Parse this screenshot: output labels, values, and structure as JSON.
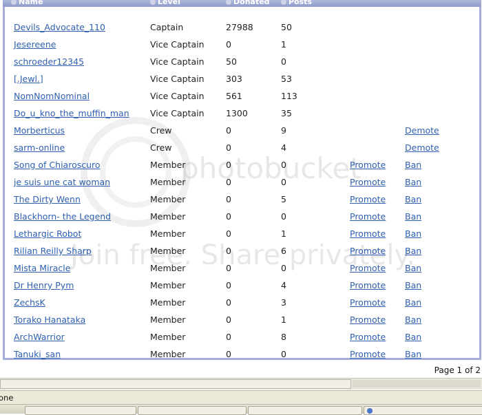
{
  "columns": {
    "name": "Name",
    "level": "Level",
    "donated": "Donated",
    "posts": "Posts"
  },
  "members": [
    {
      "name": "Devils_Advocate_110",
      "level": "Captain",
      "donated": "27988",
      "posts": "50",
      "promote": "",
      "action": ""
    },
    {
      "name": "Jesereene",
      "level": "Vice Captain",
      "donated": "0",
      "posts": "1",
      "promote": "",
      "action": ""
    },
    {
      "name": "schroeder12345",
      "level": "Vice Captain",
      "donated": "50",
      "posts": "0",
      "promote": "",
      "action": ""
    },
    {
      "name": "[.Jewl.]",
      "level": "Vice Captain",
      "donated": "303",
      "posts": "53",
      "promote": "",
      "action": ""
    },
    {
      "name": "NomNomNominal",
      "level": "Vice Captain",
      "donated": "561",
      "posts": "113",
      "promote": "",
      "action": ""
    },
    {
      "name": "Do_u_kno_the_muffin_man",
      "level": "Vice Captain",
      "donated": "1300",
      "posts": "35",
      "promote": "",
      "action": ""
    },
    {
      "name": "Morberticus",
      "level": "Crew",
      "donated": "0",
      "posts": "9",
      "promote": "",
      "action": "Demote"
    },
    {
      "name": "sarm-online",
      "level": "Crew",
      "donated": "0",
      "posts": "4",
      "promote": "",
      "action": "Demote"
    },
    {
      "name": "Song of Chiaroscuro",
      "level": "Member",
      "donated": "0",
      "posts": "0",
      "promote": "Promote",
      "action": "Ban"
    },
    {
      "name": "je suis une cat woman",
      "level": "Member",
      "donated": "0",
      "posts": "0",
      "promote": "Promote",
      "action": "Ban"
    },
    {
      "name": "The Dirty Wenn",
      "level": "Member",
      "donated": "0",
      "posts": "5",
      "promote": "Promote",
      "action": "Ban"
    },
    {
      "name": "Blackhorn- the Legend",
      "level": "Member",
      "donated": "0",
      "posts": "0",
      "promote": "Promote",
      "action": "Ban"
    },
    {
      "name": "Lethargic Robot",
      "level": "Member",
      "donated": "0",
      "posts": "1",
      "promote": "Promote",
      "action": "Ban"
    },
    {
      "name": "Rilian Reilly Sharp",
      "level": "Member",
      "donated": "0",
      "posts": "6",
      "promote": "Promote",
      "action": "Ban"
    },
    {
      "name": "Mista Miracle",
      "level": "Member",
      "donated": "0",
      "posts": "0",
      "promote": "Promote",
      "action": "Ban"
    },
    {
      "name": "Dr Henry Pym",
      "level": "Member",
      "donated": "0",
      "posts": "4",
      "promote": "Promote",
      "action": "Ban"
    },
    {
      "name": "ZechsK",
      "level": "Member",
      "donated": "0",
      "posts": "3",
      "promote": "Promote",
      "action": "Ban"
    },
    {
      "name": "Torako Hanataka",
      "level": "Member",
      "donated": "0",
      "posts": "1",
      "promote": "Promote",
      "action": "Ban"
    },
    {
      "name": "ArchWarrior",
      "level": "Member",
      "donated": "0",
      "posts": "8",
      "promote": "Promote",
      "action": "Ban"
    },
    {
      "name": "Tanuki_san",
      "level": "Member",
      "donated": "0",
      "posts": "0",
      "promote": "Promote",
      "action": "Ban"
    }
  ],
  "footer": {
    "page_info": "Page 1 of 2"
  },
  "status_bar": {
    "text": "one"
  },
  "watermark": {
    "logo": "photobucket",
    "tagline": "Join free. Share privately."
  },
  "colors": {
    "link": "#2e5fb0",
    "header": "#8f9bcc",
    "border": "#a5aed8"
  }
}
